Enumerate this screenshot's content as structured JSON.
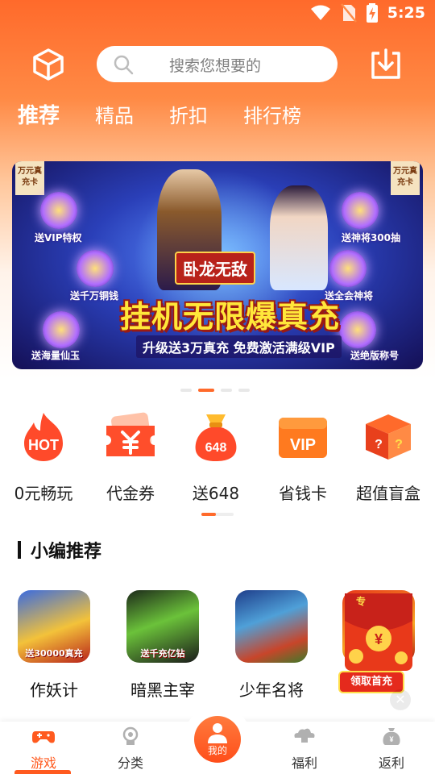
{
  "status_bar": {
    "time": "5:25"
  },
  "search": {
    "placeholder": "搜索您想要的"
  },
  "tabs": [
    {
      "label": "推荐",
      "active": true
    },
    {
      "label": "精品",
      "active": false
    },
    {
      "label": "折扣",
      "active": false
    },
    {
      "label": "排行榜",
      "active": false
    }
  ],
  "banner": {
    "logo_text": "卧龙无敌",
    "main_title": "挂机无限爆真充",
    "sub_title": "升级送3万真充 免费激活满级VIP",
    "left_labels": [
      "送VIP特权",
      "送千万铜钱",
      "送海量仙玉"
    ],
    "right_labels": [
      "送神将300抽",
      "送全会神将",
      "送绝版称号"
    ],
    "corner_tag": "万元真充卡",
    "pager": {
      "count": 4,
      "active_index": 1
    }
  },
  "quick_entries": [
    {
      "label": "0元畅玩",
      "icon": "hot-flame-icon",
      "icon_text": "HOT"
    },
    {
      "label": "代金券",
      "icon": "coupon-icon",
      "icon_text": ""
    },
    {
      "label": "送648",
      "icon": "money-bag-icon",
      "icon_text": "648"
    },
    {
      "label": "省钱卡",
      "icon": "vip-card-icon",
      "icon_text": "VIP"
    },
    {
      "label": "超值盲盒",
      "icon": "mystery-box-icon",
      "icon_text": "?"
    }
  ],
  "section": {
    "title": "小编推荐"
  },
  "games": [
    {
      "name": "作妖计",
      "caption": "送30000真充"
    },
    {
      "name": "暗黑主宰",
      "caption": "送千充亿钻"
    },
    {
      "name": "少年名将",
      "caption": ""
    },
    {
      "name": "",
      "caption": ""
    }
  ],
  "float_ad": {
    "button": "领取首充",
    "partial_text": "专"
  },
  "bottom_nav": [
    {
      "label": "游戏",
      "icon": "gamepad-icon",
      "active": true
    },
    {
      "label": "分类",
      "icon": "category-icon",
      "active": false
    },
    {
      "label": "我的",
      "icon": "user-icon",
      "active": false,
      "center": true
    },
    {
      "label": "福利",
      "icon": "gift-cloud-icon",
      "active": false
    },
    {
      "label": "返利",
      "icon": "money-bag-nav-icon",
      "active": false
    }
  ],
  "colors": {
    "accent": "#ff5a1f",
    "header_top": "#ff6a2b"
  }
}
